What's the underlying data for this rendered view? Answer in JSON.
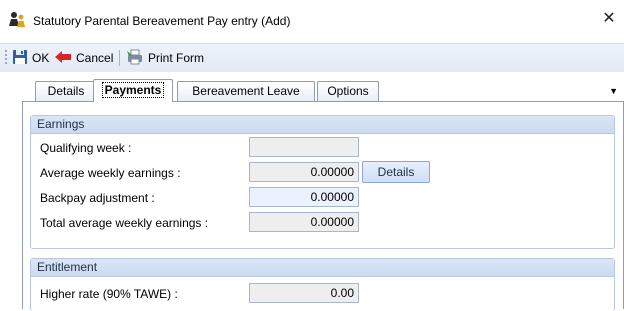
{
  "window": {
    "title": "Statutory Parental Bereavement Pay entry (Add)",
    "close_glyph": "✕",
    "icon": "people-icon"
  },
  "toolbar": {
    "ok_label": "OK",
    "cancel_label": "Cancel",
    "print_label": "Print Form"
  },
  "tabs": [
    {
      "label": "Details",
      "active": false
    },
    {
      "label": "Payments",
      "active": true
    },
    {
      "label": "Bereavement Leave",
      "active": false
    },
    {
      "label": "Options",
      "active": false
    }
  ],
  "earnings": {
    "header": "Earnings",
    "qualifying_week_label": "Qualifying week :",
    "qualifying_week_value": "",
    "avg_weekly_label": "Average weekly earnings :",
    "avg_weekly_value": "0.00000",
    "details_button": "Details",
    "backpay_label": "Backpay adjustment :",
    "backpay_value": "0.00000",
    "total_avg_label": "Total average weekly earnings :",
    "total_avg_value": "0.00000"
  },
  "entitlement": {
    "header": "Entitlement",
    "higher_rate_label": "Higher rate (90% TAWE) :",
    "higher_rate_value": "0.00"
  },
  "colors": {
    "group_header": "#cbdaef",
    "editable_field": "#eaf2fd",
    "readonly_field": "#eeeeee"
  }
}
